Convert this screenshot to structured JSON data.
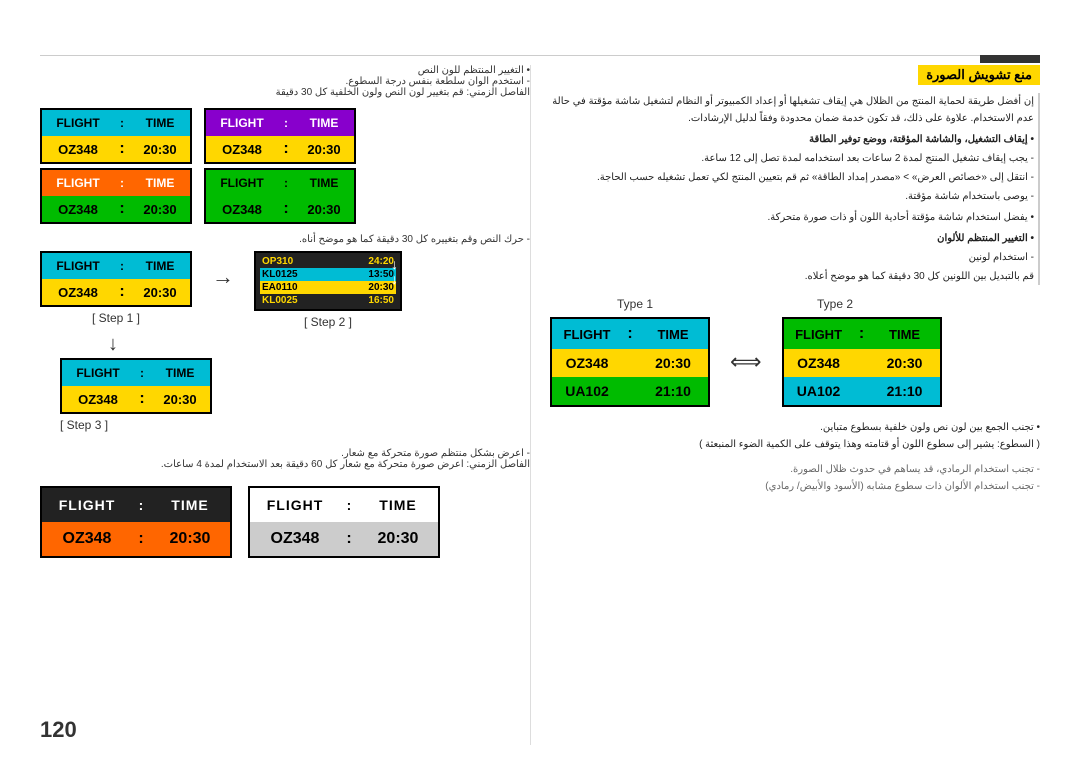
{
  "page": {
    "number": "120",
    "topBorder": true
  },
  "right_section": {
    "title_ar": "منع تشويش الصورة",
    "body_ar_lines": [
      "إن أفضل طريقة لحماية المنتج من الظلال هي إيقاف تشغيلها أو إعداد الكمبيوتر أو النظام لتشغيل شاشة مؤقتة في حالة عدم الاستخدام. علاوة على ذلك، قد تكون خدمة ضمان محدودة وفقاً لدليل الإرشادات.",
      "• إيقاف التشغيل، والشاشة المؤقتة، ووضع توفير الطاقة",
      "- يجب إيقاف تشغيل المنتج لمدة 2 ساعات بعد استخدامه لمدة تصل إلى 12 ساعة.",
      "- انتقل إلى «خصائص العرض» > «مصدر إمداد الطاقة» ثم قم بتعيين المنتج لكي تعمل تشغيله حسب الحاجة.",
      "- يوصى باستخدام شاشة مؤقتة.",
      "• يفضل استخدام شاشة مؤقتة أحادية اللون أو ذات صورة متحركة.",
      "• التغيير المنتظم للألوان",
      "- استخدام لونين",
      "قم بالتبديل بين اللونين كل 30 دقيقة كما هو موضح أعلاه."
    ],
    "color_note_ar": "• تجنب الجمع بين لون نص ولون خلفية بسطوع متباين. ( السطوع: يشير إلى سطوع اللون أو قتامته وهذا يتوقف على الكمية الضوء المنبعثة )",
    "gray_note1_ar": "- تجنب استخدام الرمادي، قد يساهم في حدوث ظلال الصورة.",
    "gray_note2_ar": "- تجنب استخدام الألوان ذات سطوع مشابه (الأسود والأبيض/ رمادي)",
    "type1_label": "Type 1",
    "type2_label": "Type 2"
  },
  "left_section": {
    "note1_ar": "• التغيير المنتظم للون النص",
    "note2_ar": "- استخدم الوان سلطعة بنفس درجة السطوع.",
    "note3_ar": "الفاصل الزمني: قم بتغيير لون النص ولون الخلفية كل 30 دقيقة",
    "note4_ar": "- حرك النص وقم بتغييره كل 30 دقيقة كما هو موضح أناه.",
    "note5_ar": "- اعرض بشكل منتظم صورة متحركة مع شعار.",
    "note6_ar": "الفاصل الزمني: اعرض صورة متحركة مع شعار كل 60 دقيقة بعد الاستخدام لمدة 4 ساعات.",
    "step1_label": "[ Step 1 ]",
    "step2_label": "[ Step 2 ]",
    "step3_label": "[ Step 3 ]"
  },
  "widgets": {
    "cyan_yellow": {
      "header_bg": "#00bcd4",
      "header_text_color": "#000",
      "header_label": "FLIGHT",
      "header_separator": ":",
      "header_value": "TIME",
      "value_bg": "#ffd700",
      "value_text_color": "#000",
      "row_label": "OZ348",
      "row_sep": ":",
      "row_value": "20:30"
    },
    "purple_yellow": {
      "header_bg": "#8b00ff",
      "header_text_color": "#fff",
      "header_label": "FLIGHT",
      "header_separator": ":",
      "header_value": "TIME",
      "value_bg": "#ffd700",
      "value_text_color": "#000",
      "row_label": "OZ348",
      "row_sep": ":",
      "row_value": "20:30"
    },
    "orange_green": {
      "header_bg": "#ff6600",
      "header_text_color": "#fff",
      "header_label": "FLIGHT",
      "header_separator": ":",
      "header_value": "TIME",
      "value_bg": "#00cc00",
      "value_text_color": "#000",
      "row_label": "OZ348",
      "row_sep": ":",
      "row_value": "20:30"
    },
    "green_green": {
      "header_bg": "#00cc00",
      "header_text_color": "#000",
      "header_label": "FLIGHT",
      "header_separator": ":",
      "header_value": "TIME",
      "value_bg": "#00cc00",
      "value_text_color": "#000",
      "row_label": "OZ348",
      "row_sep": ":",
      "row_value": "20:30"
    }
  },
  "flight_label": "FLIGHT",
  "time_label": "TIME",
  "oz348": "OZ348",
  "time_2030": "20:30",
  "time_2110": "21:10",
  "ua102": "UA102",
  "step_scroll_codes": [
    "OP310 : 24:20",
    "KL0125 : 13:50",
    "EA0110 : 20:30",
    "KL0025 : 16:50"
  ]
}
